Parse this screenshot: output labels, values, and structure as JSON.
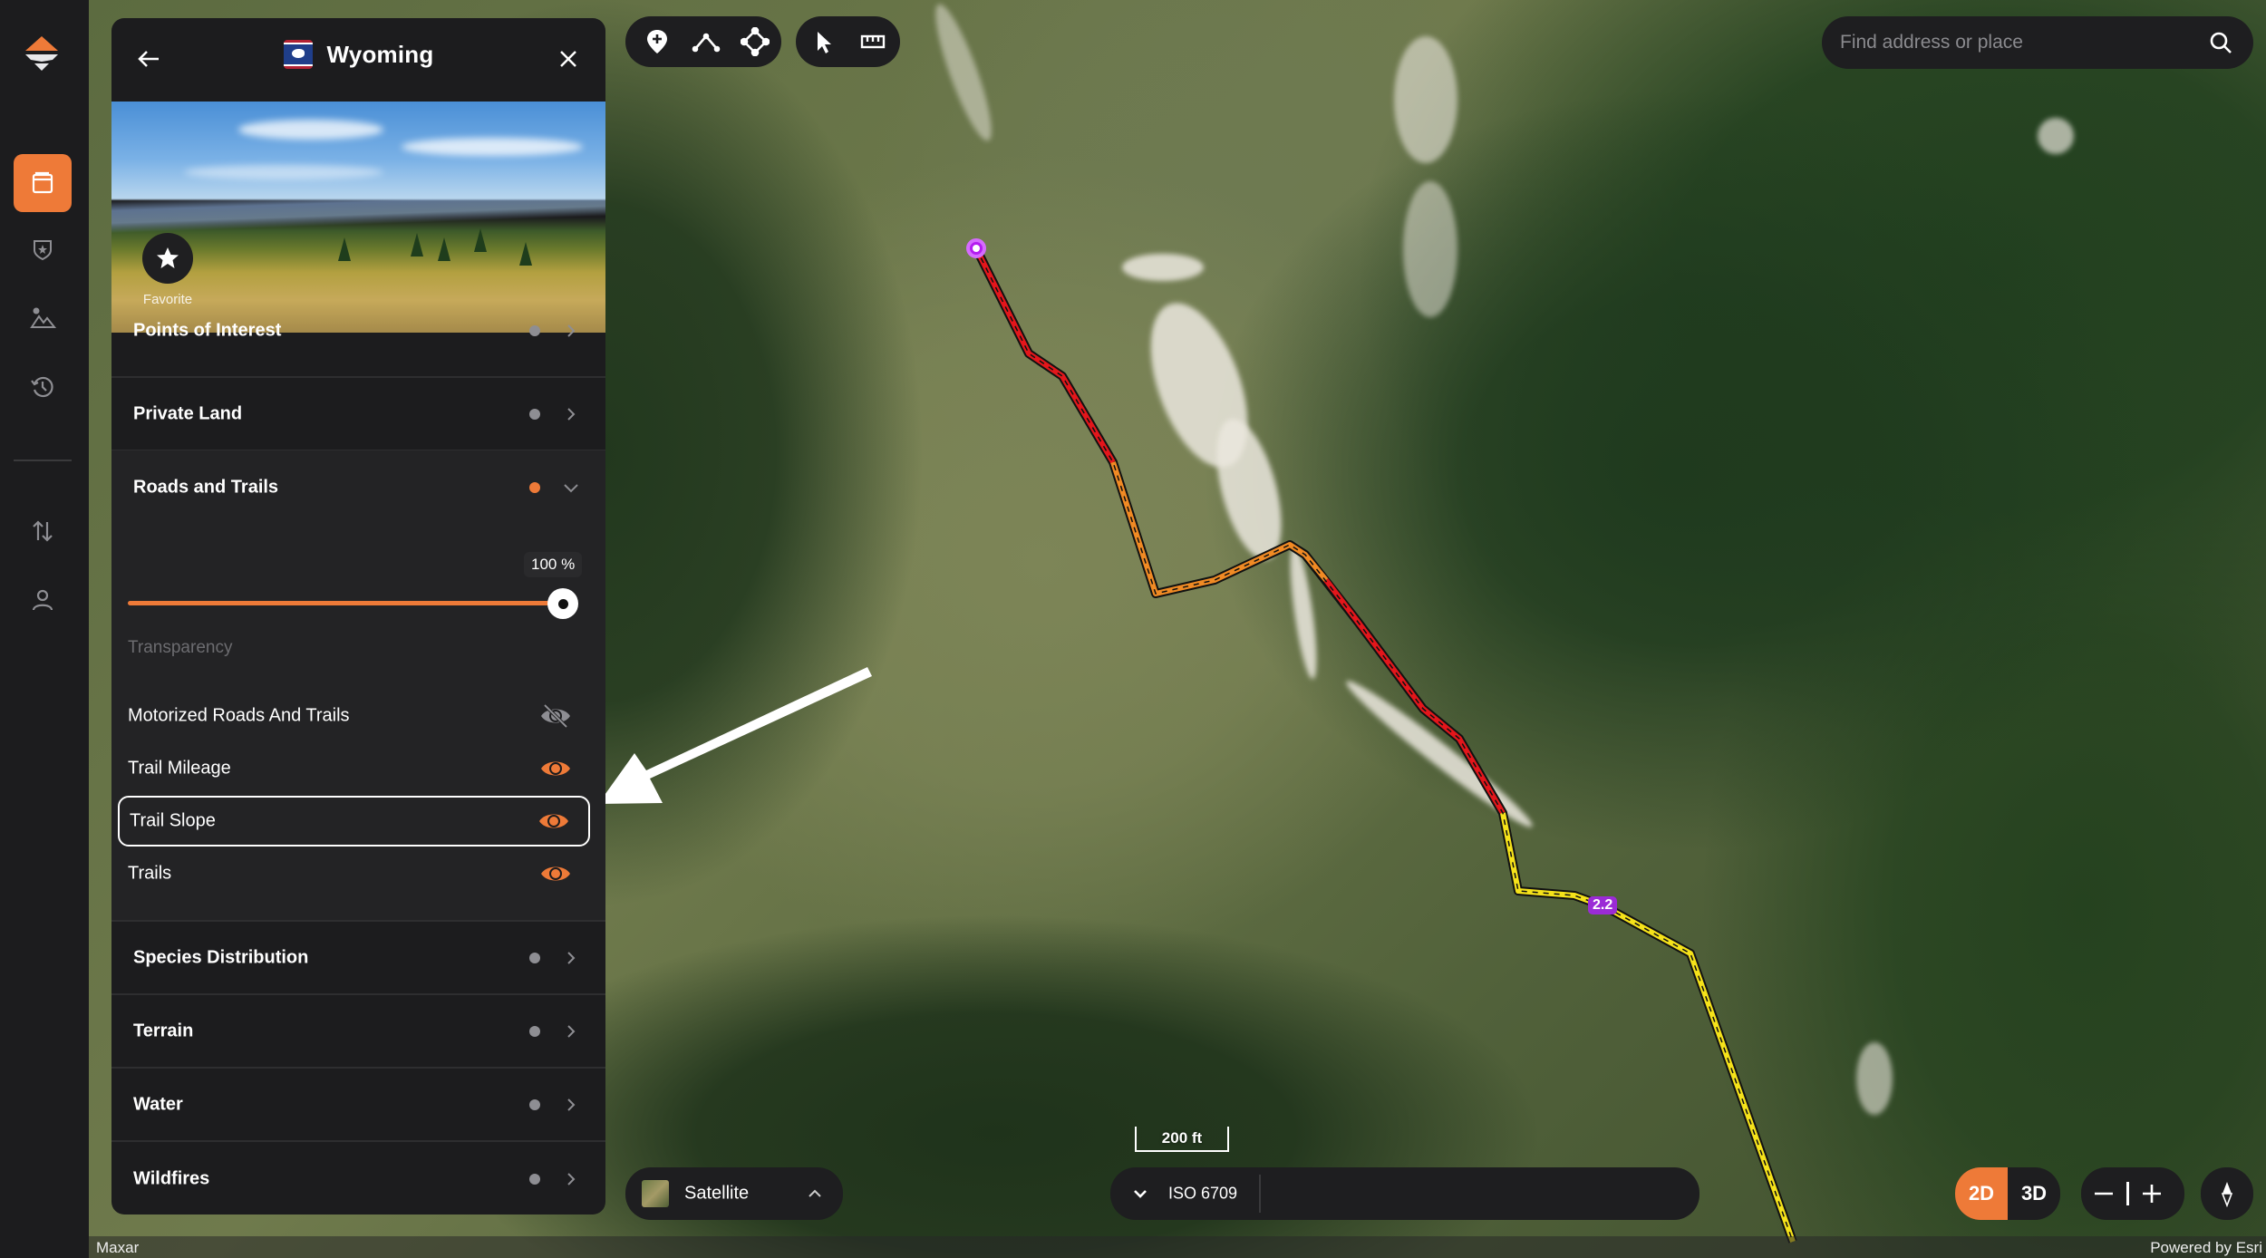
{
  "app": {
    "brand_color": "#ee7a38",
    "rail": {
      "logo_icon": "onx-logo-icon",
      "items": [
        {
          "name": "map-layers",
          "icon": "layers-book-icon",
          "active": true
        },
        {
          "name": "saved-areas",
          "icon": "shield-star-icon",
          "active": false
        },
        {
          "name": "photos",
          "icon": "mountain-image-icon",
          "active": false
        },
        {
          "name": "history",
          "icon": "history-icon",
          "active": false
        },
        {
          "name": "sync",
          "icon": "sort-arrows-icon",
          "active": false
        },
        {
          "name": "account",
          "icon": "user-icon",
          "active": false
        }
      ]
    }
  },
  "panel": {
    "title": "Wyoming",
    "flag_icon": "wyoming-flag-icon",
    "favorite_label": "Favorite",
    "layers": [
      {
        "label": "Points of Interest",
        "active": false
      },
      {
        "label": "Private Land",
        "active": false
      },
      {
        "label": "Roads and Trails",
        "active": true,
        "expanded": true
      },
      {
        "label": "Species Distribution",
        "active": false
      },
      {
        "label": "Terrain",
        "active": false
      },
      {
        "label": "Water",
        "active": false
      },
      {
        "label": "Wildfires",
        "active": false
      }
    ],
    "roads_and_trails": {
      "transparency_value": "100 %",
      "transparency_percent": 100,
      "transparency_label": "Transparency",
      "sublayers": [
        {
          "label": "Motorized Roads And Trails",
          "visible": false
        },
        {
          "label": "Trail Mileage",
          "visible": true
        },
        {
          "label": "Trail Slope",
          "visible": true,
          "highlighted": true
        },
        {
          "label": "Trails",
          "visible": true
        }
      ]
    }
  },
  "toolbar": {
    "draw_tools": [
      "add-waypoint-icon",
      "draw-line-icon",
      "draw-shape-icon"
    ],
    "other_tools": [
      "select-pointer-icon",
      "measure-ruler-icon"
    ]
  },
  "search": {
    "placeholder": "Find address or place",
    "value": ""
  },
  "map": {
    "scale_label": "200 ft",
    "trail_mile_marker": "2.2",
    "basemap_label": "Satellite",
    "iso_label": "ISO 6709",
    "view_modes": [
      "2D",
      "3D"
    ],
    "active_view_mode": "2D",
    "attribution_left": "Maxar",
    "attribution_right": "Powered by Esri"
  }
}
